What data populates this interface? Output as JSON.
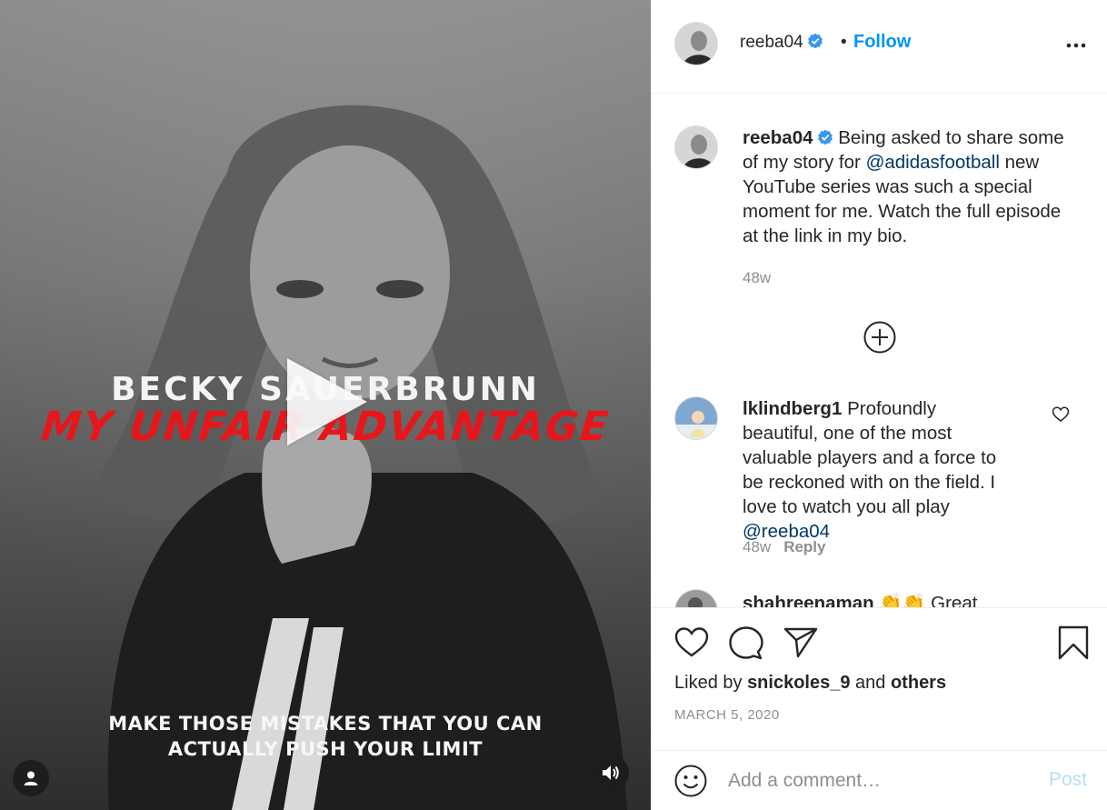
{
  "media": {
    "overlay_name": "BECKY SAUERBRUNN",
    "overlay_series": "MY UNFAIR ADVANTAGE",
    "caption_line_1": "MAKE THOSE MISTAKES THAT YOU CAN",
    "caption_line_2": "ACTUALLY PUSH YOUR LIMIT"
  },
  "header": {
    "username": "reeba04",
    "separator": "•",
    "follow_label": "Follow"
  },
  "post_caption": {
    "username": "reeba04",
    "text_before": "Being asked to share some of my story for ",
    "mention": "@adidasfootball",
    "text_after": " new YouTube series was such a special moment for me. Watch the full episode at the link in my bio.",
    "age": "48w"
  },
  "comments": [
    {
      "username": "lklindberg1",
      "text_before": "Profoundly beautiful, one of the most valuable players and a force to be reckoned with on the field. I love to watch you all play ",
      "mention": "@reeba04",
      "age": "48w",
      "reply_label": "Reply"
    },
    {
      "username": "shahreenaman",
      "text": "👏👏 Great"
    }
  ],
  "likes": {
    "prefix": "Liked by ",
    "user": "snickoles_9",
    "middle": " and ",
    "others": "others"
  },
  "date": "MARCH 5, 2020",
  "comment_box": {
    "placeholder": "Add a comment…",
    "post_label": "Post"
  },
  "colors": {
    "accent": "#0095f6",
    "verified": "#3897f0",
    "mention": "#00376b",
    "overlay_red": "#e8161b"
  }
}
